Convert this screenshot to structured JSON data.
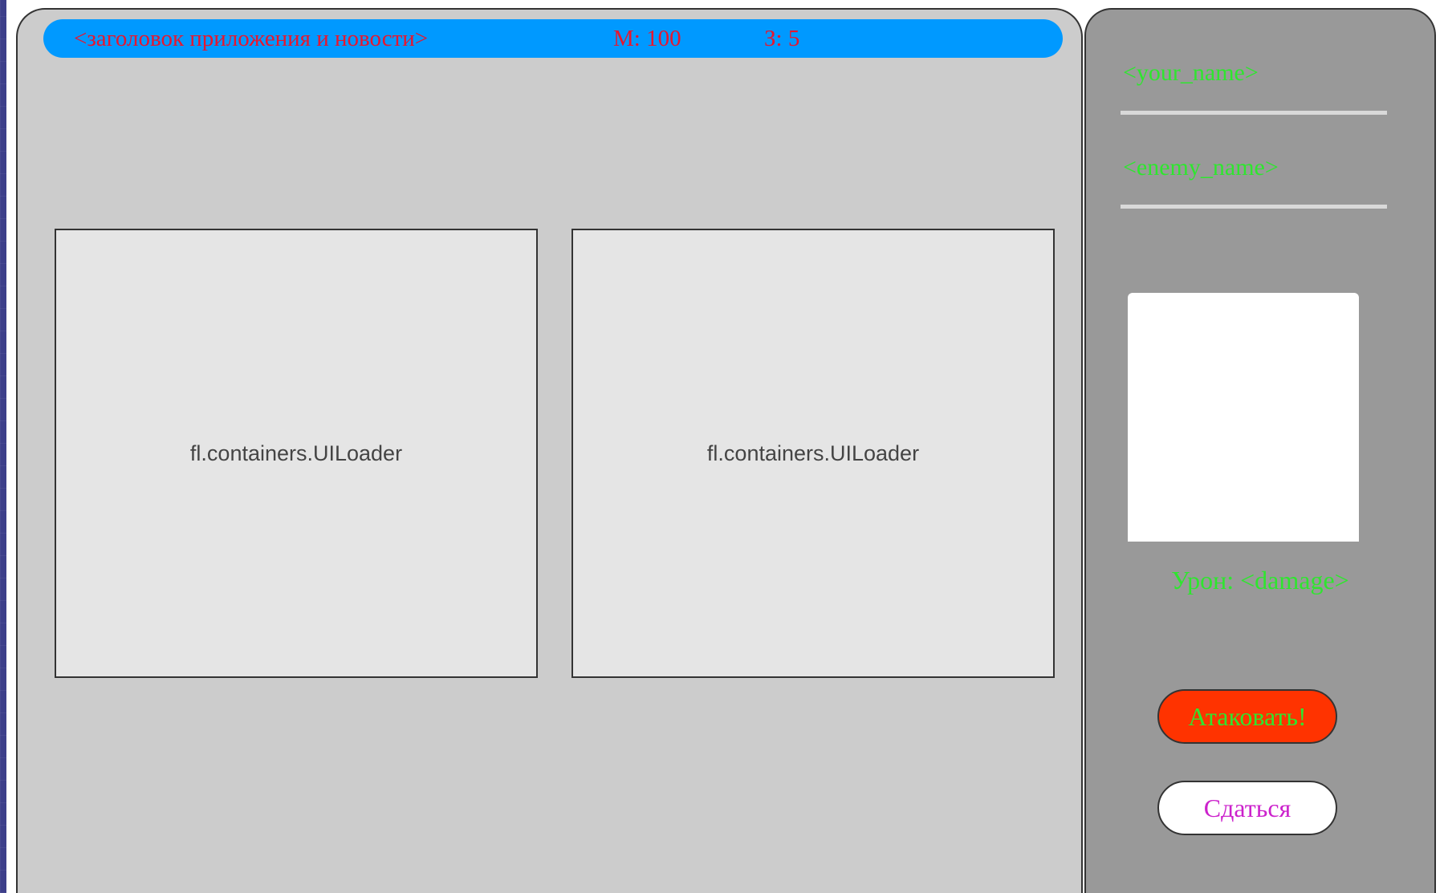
{
  "header": {
    "title": "<заголовок приложения и новости>",
    "money": "М: 100",
    "z": "З: 5"
  },
  "loaders": [
    {
      "label": "fl.containers.UILoader"
    },
    {
      "label": "fl.containers.UILoader"
    }
  ],
  "side_panel": {
    "your_name": "<your_name>",
    "enemy_name": "<enemy_name>",
    "damage": "Урон: <damage>",
    "attack_label": "Атаковать!",
    "surrender_label": "Сдаться"
  },
  "colors": {
    "header_bar": "#0099ff",
    "header_text": "#e8162e",
    "side_text": "#2ee62e",
    "attack_button": "#ff3300",
    "surrender_text": "#cc22cc"
  }
}
